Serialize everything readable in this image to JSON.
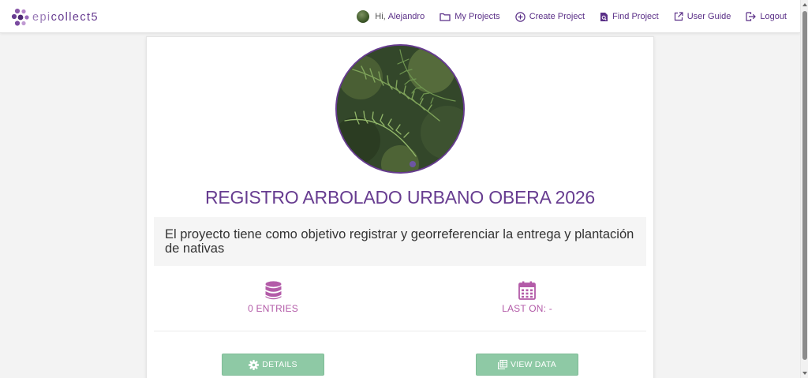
{
  "navbar": {
    "brand": {
      "prefix": "epi",
      "suffix": "collect5"
    },
    "user": {
      "greeting": "Hi,",
      "name": "Alejandro"
    },
    "items": [
      {
        "label": "My Projects",
        "icon": "folder-icon"
      },
      {
        "label": "Create Project",
        "icon": "plus-circle-icon"
      },
      {
        "label": "Find Project",
        "icon": "search-file-icon"
      },
      {
        "label": "User Guide",
        "icon": "external-link-icon"
      },
      {
        "label": "Logout",
        "icon": "logout-icon"
      }
    ]
  },
  "project": {
    "title": "REGISTRO ARBOLADO URBANO OBERA 2026",
    "description": "El proyecto tiene como objetivo registrar y georreferenciar la entrega y plantación de nativas",
    "stats": {
      "entries": {
        "label": "0 ENTRIES",
        "icon": "database-icon"
      },
      "last_on": {
        "label": "LAST ON: -",
        "icon": "calendar-icon"
      }
    }
  },
  "actions": {
    "details_label": "DETAILS",
    "view_data_label": "VIEW DATA"
  },
  "colors": {
    "brand_purple": "#673c90",
    "stat_magenta": "#b35ba8",
    "button_green": "#8ec9a5"
  }
}
